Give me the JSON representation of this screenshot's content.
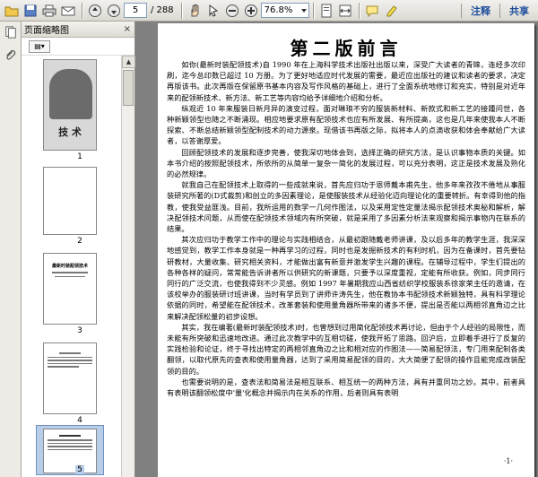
{
  "toolbar": {
    "page_current": "5",
    "page_total": "/ 288",
    "zoom": "76.8%",
    "annotate_label": "注释",
    "share_label": "共享"
  },
  "sidebar": {
    "title": "页面缩略图",
    "close": "×",
    "options_label": "▤▾",
    "thumbnails": [
      {
        "page": "1",
        "cover_title": "技 术"
      },
      {
        "page": "2"
      },
      {
        "page": "3",
        "head": "最新时装配领技术"
      },
      {
        "page": "4"
      },
      {
        "page": "5"
      }
    ]
  },
  "document": {
    "title": "第二版前言",
    "page_number": "·1·",
    "paragraphs": [
      "如你(最新时装配领技术)自 1990 年在上海科学技术出版社出版以来，深受广大读者的青睐，连经多次印刷，迄今总印数已超过 10 万册。为了更好地适应时代发展的需要，最近应出版社的建议和读者的要求，决定再版该书。此次再版在保留原书基本内容及写作风格的基础上，进行了全面系统地修订和充实，特别是对近年来的配领新技术、新方法、新工艺等内容均给予详细地介绍和分析。",
      "纵观近 10 年来服装日新月异的演变过程，面对琳琅不穷的服装新材料、新款式和新工艺的接踵问世，各种新颖领型也随之不断涌现。相应地要求原有配领技术也应有所发展、有所提高，这也是几年来使我本人不断探索、不断总结新颖领型配制技术的动力源泉。现借该书再版之际，拟将本人的点滴收获和体会奉献给广大读者，以答谢厚爱。",
      "回顾配领技术的发展和逐步完善，使我深切地体会到，选择正确的研究方法，是认识事物本质的关键。如本书介绍的按照配领技术，所依所的从简单一复杂一简化的发展过程，可以充分表明，这正是技术发展及熟化的必然规律。",
      "就我自己在配领技术上取得的一些成就来说，首先应归功于恩师戴本甫先生，他多年来孜孜不倦地从事服装研究所著的(D式裁剪)和创立的多因素理论，是使服装技术从经验化迈向理论化的重要转折。有幸得到他的指教，使我受益匪浅。目前，我所运用的数学一几何作图法，以及采用定性定量法揭示配领技术奥秘和解析，解决配领技术问题，从而使在配领技术领域内有所突破，就是采用了多因素分析法来观察和揭示事物内在联系的结果。",
      "其次应归功于教学工作中的理论与实践相结合，从最初跟随戴老师讲课，及以后多年的教学生涯，我深深地感觉到，教学工作本身就是一种再学习的过程，同时也是发掘新技术的有利时机，因为在备课时，首先要钻研教材，大量收集、研究相关资料，才能做出富有新意并激发学生兴趣的课程。在辅导过程中，学生们提出的各种各样的疑问，常常能告诉讲者所以供研究的新课题，只要予以深度重视，定能有所收获。例如，同步同行同行的广泛交流，也使我得到不少灵感。例如 1997 年暑期我应山西省纺织学校服装系徐家荣主任的邀请，在该校举办的服装研讨班讲课，当时有学员到了讲师许涛先生，他在教协本书配领技术新颖独特，具有科学理论依据的同时，希望能在配领技术，改革套装和使用量角器所带来的诸多不便，提出是否能以两相邻直角边之比来解决配领松量的初步设想。",
      "其实，我在编著(最新时装配领技术)时，也曾想到过用简化配领技术再讨论，但由于个人经验的局限性，而未能有所突破和迅速地改进。通过此次教学中的互相切磋，使我开拓了思路。回沪后，立即着手进行了反复的实践检验和论证，终于寻找出特定的两相邻直角边之比和相对应的作图法——简易配领法，专门用来配制各类翻领，以取代原先的查表和使用量角器，达到了采用简易配领的目的，大大简便了配领的操作且能完成改装配领的目的。",
      "也需要说明的是，查表法和简易法是相互联系、相互统一的两种方法，具有并重同功之妙。其中，前者具有表明该翻领松度中'量'化概念并揭示内在关系的作用，后者则具有表明"
    ]
  }
}
